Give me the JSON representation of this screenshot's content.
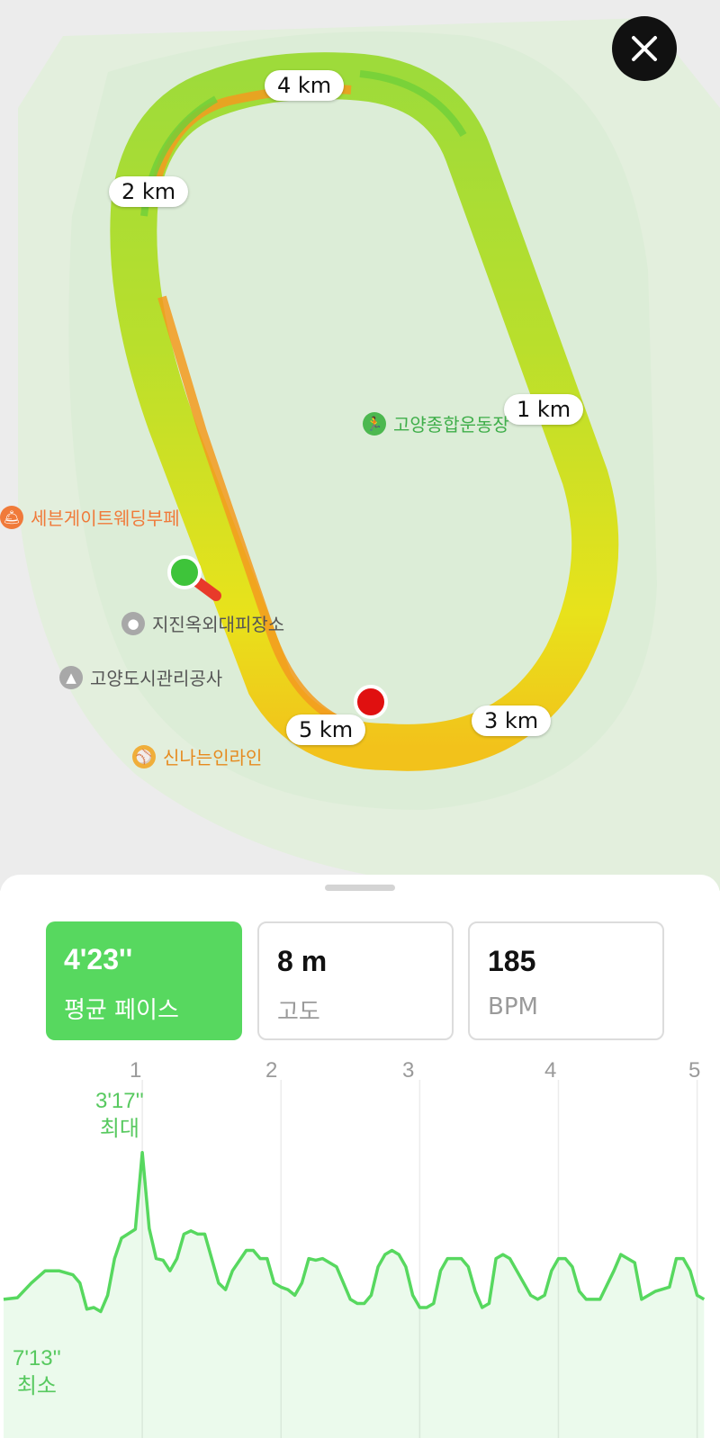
{
  "map": {
    "km_markers": [
      "4 km",
      "2 km",
      "1 km",
      "3 km",
      "5 km"
    ],
    "pois": [
      {
        "name": "고양종합운동장",
        "icon": "running-icon",
        "color": "#3fae4a"
      },
      {
        "name": "세븐게이트웨딩부페",
        "icon": "restaurant-icon",
        "color": "#f07a3a"
      },
      {
        "name": "지진옥외대피장소",
        "icon": "shelter-icon",
        "color": "#555555"
      },
      {
        "name": "고양도시관리공사",
        "icon": "building-icon",
        "color": "#555555"
      },
      {
        "name": "신나는인라인",
        "icon": "sports-icon",
        "color": "#e68a1e"
      }
    ],
    "start_marker_color": "#3ec43a",
    "end_marker_color": "#e01010"
  },
  "close_button": {
    "icon": "close-icon"
  },
  "stats": [
    {
      "value": "4'23''",
      "label": "평균 페이스",
      "active": true
    },
    {
      "value": "8 m",
      "label": "고도",
      "active": false
    },
    {
      "value": "185",
      "label": "BPM",
      "active": false
    }
  ],
  "chart_data": {
    "type": "line",
    "x_unit": "km",
    "x_ticks": [
      "1",
      "2",
      "3",
      "4",
      "5"
    ],
    "xlim": [
      0,
      5.1
    ],
    "series": [
      {
        "color": "#57d85f",
        "x": [
          0.0,
          0.1,
          0.2,
          0.3,
          0.4,
          0.5,
          0.55,
          0.6,
          0.65,
          0.7,
          0.75,
          0.8,
          0.85,
          0.95,
          1.0,
          1.05,
          1.1,
          1.15,
          1.2,
          1.25,
          1.3,
          1.35,
          1.4,
          1.45,
          1.5,
          1.55,
          1.6,
          1.65,
          1.75,
          1.8,
          1.85,
          1.9,
          1.95,
          2.0,
          2.05,
          2.1,
          2.15,
          2.2,
          2.25,
          2.3,
          2.4,
          2.5,
          2.55,
          2.6,
          2.65,
          2.7,
          2.75,
          2.8,
          2.85,
          2.9,
          2.95,
          3.0,
          3.05,
          3.1,
          3.15,
          3.2,
          3.3,
          3.35,
          3.4,
          3.45,
          3.5,
          3.55,
          3.6,
          3.65,
          3.7,
          3.8,
          3.85,
          3.9,
          3.95,
          4.0,
          4.05,
          4.1,
          4.15,
          4.2,
          4.3,
          4.4,
          4.45,
          4.5,
          4.55,
          4.6,
          4.7,
          4.8,
          4.85,
          4.9,
          4.95,
          5.0,
          5.05
        ],
        "y_pace_seconds": [
          380,
          378,
          360,
          345,
          345,
          350,
          360,
          392,
          390,
          395,
          375,
          330,
          305,
          294,
          200,
          293,
          330,
          332,
          345,
          330,
          300,
          296,
          300,
          300,
          330,
          360,
          368,
          345,
          320,
          320,
          330,
          330,
          360,
          365,
          368,
          375,
          360,
          330,
          332,
          330,
          340,
          380,
          385,
          385,
          375,
          340,
          325,
          320,
          325,
          340,
          375,
          390,
          390,
          385,
          345,
          330,
          330,
          340,
          370,
          390,
          385,
          330,
          325,
          330,
          345,
          375,
          380,
          375,
          345,
          330,
          330,
          340,
          370,
          380,
          380,
          345,
          325,
          330,
          335,
          380,
          370,
          365,
          330,
          330,
          345,
          375,
          380
        ]
      }
    ],
    "annotations": [
      {
        "value": "3'17''",
        "label": "최대"
      },
      {
        "value": "7'13''",
        "label": "최소"
      }
    ]
  }
}
